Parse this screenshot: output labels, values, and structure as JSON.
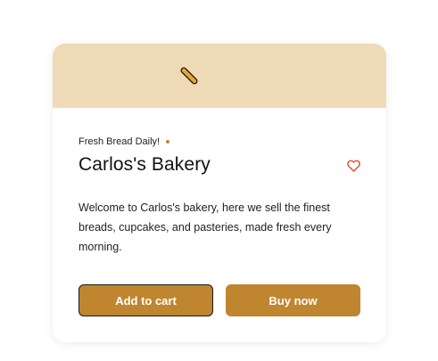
{
  "product_card": {
    "tagline": "Fresh Bread Daily!",
    "title": "Carlos's Bakery",
    "description": "Welcome to Carlos's bakery, here we sell the finest breads, cupcakes, and pasteries, made fresh every morning.",
    "banner_icon": "baguette-icon",
    "favorite_icon": "heart-icon",
    "add_to_cart_label": "Add to cart",
    "buy_now_label": "Buy now"
  },
  "colors": {
    "banner_bg": "#efdab8",
    "accent": "#bf862f",
    "heart": "#e5533b",
    "dot": "#b88a2c"
  }
}
